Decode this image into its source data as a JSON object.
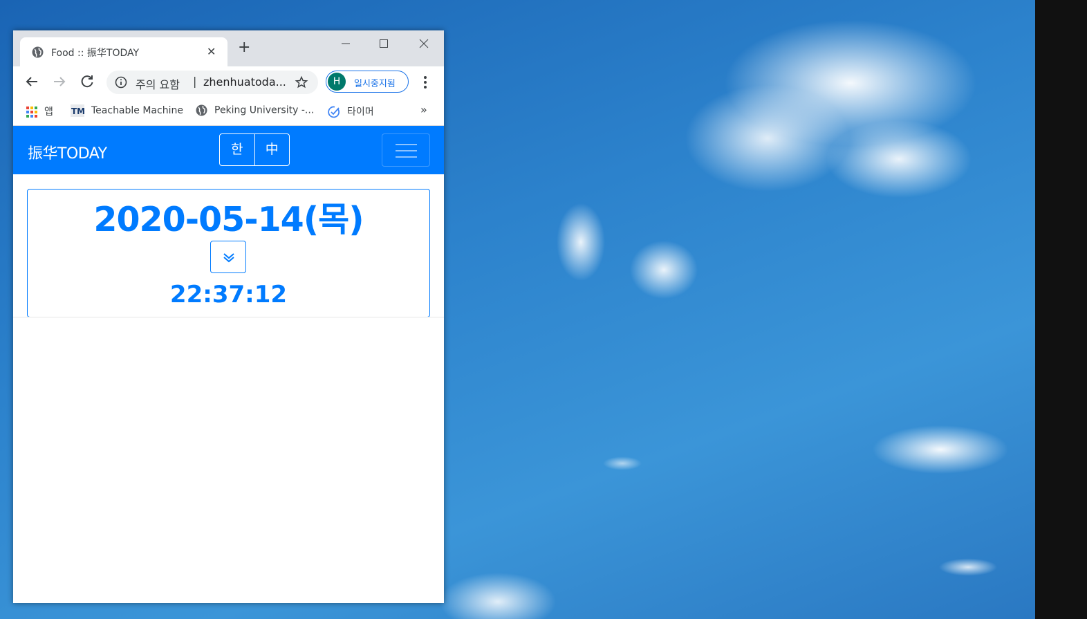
{
  "browser": {
    "tab": {
      "title": "Food :: 振华TODAY",
      "close_glyph": "✕",
      "favicon": "globe-icon"
    },
    "new_tab_glyph": "+",
    "window_controls": [
      "minimize-icon",
      "maximize-icon",
      "close-icon"
    ],
    "omnibox": {
      "warning": "주의 요함",
      "separator": "|",
      "url": "zhenhuatoda..."
    },
    "profile": {
      "initial": "H",
      "label": "일시중지됨",
      "avatar_color": "#00796b"
    },
    "bookmarks": [
      {
        "label": "앱",
        "icon": "apps-grid-icon"
      },
      {
        "label": "Teachable Machine",
        "icon": "tm-icon"
      },
      {
        "label": "Peking University -...",
        "icon": "globe-icon"
      },
      {
        "label": "타이머",
        "icon": "check-circle-icon"
      }
    ],
    "bookmarks_more": "»"
  },
  "site": {
    "brand": "振华TODAY",
    "lang_buttons": [
      "한",
      "中"
    ],
    "accent_color": "#007bff",
    "date": "2020-05-14(목)",
    "time": "22:37:12"
  }
}
